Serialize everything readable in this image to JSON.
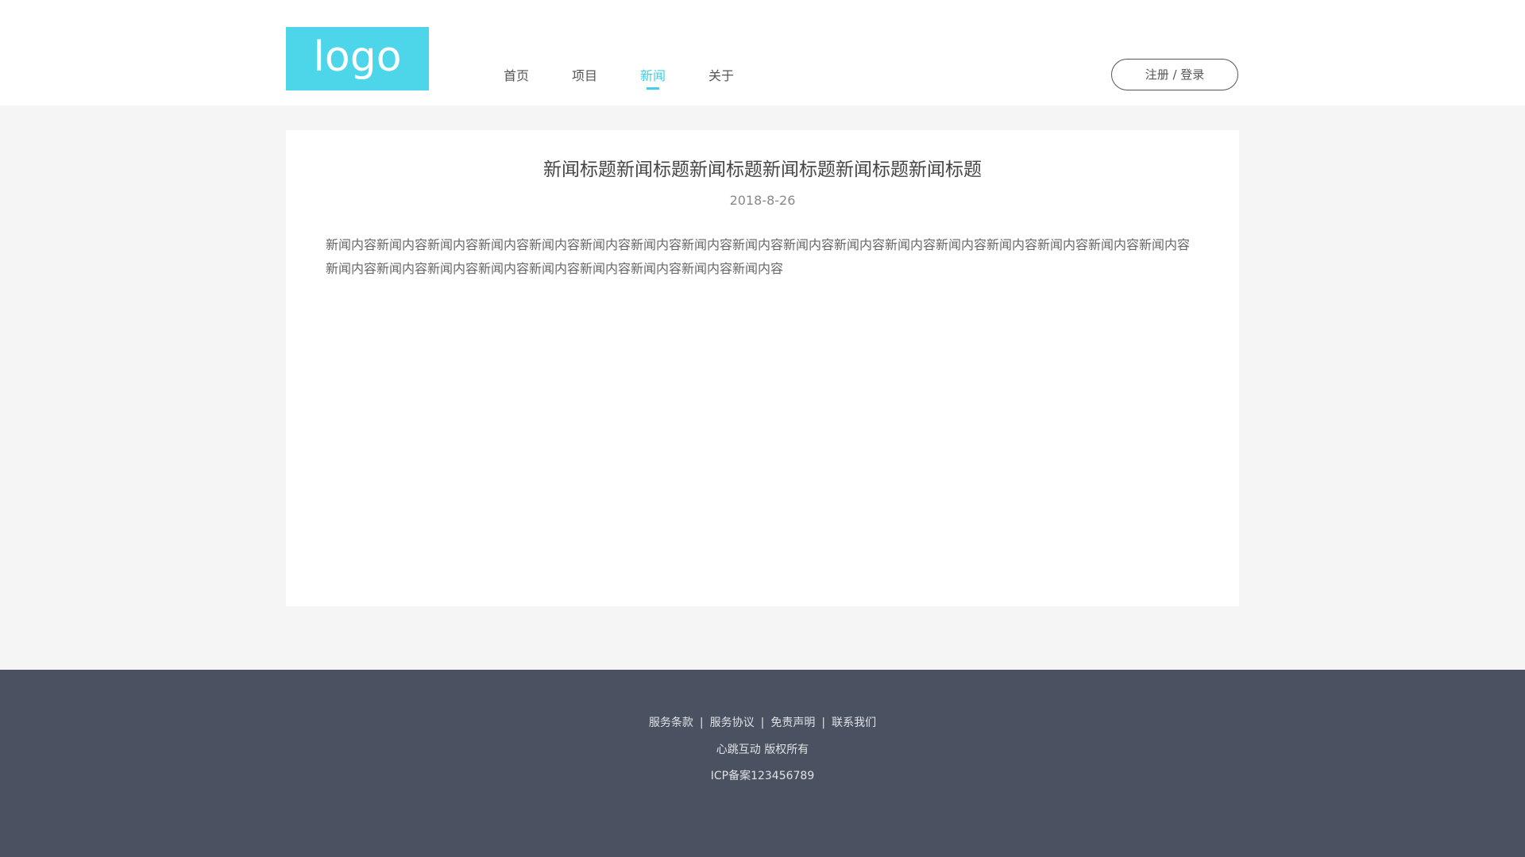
{
  "header": {
    "logo_text": "logo",
    "nav": [
      {
        "label": "首页",
        "active": false
      },
      {
        "label": "项目",
        "active": false
      },
      {
        "label": "新闻",
        "active": true
      },
      {
        "label": "关于",
        "active": false
      }
    ],
    "login_label": "注册 / 登录"
  },
  "article": {
    "title": "新闻标题新闻标题新闻标题新闻标题新闻标题新闻标题",
    "date": "2018-8-26",
    "body": "新闻内容新闻内容新闻内容新闻内容新闻内容新闻内容新闻内容新闻内容新闻内容新闻内容新闻内容新闻内容新闻内容新闻内容新闻内容新闻内容新闻内容新闻内容新闻内容新闻内容新闻内容新闻内容新闻内容新闻内容新闻内容新闻内容"
  },
  "footer": {
    "links": [
      "服务条款",
      "服务协议",
      "免责声明",
      "联系我们"
    ],
    "separator": "|",
    "copyright": "心跳互动 版权所有",
    "icp": "ICP备案123456789"
  },
  "colors": {
    "accent": "#3fd0e6",
    "logo_bg": "#4dd6ea",
    "page_bg": "#f5f5f5",
    "footer_bg": "#4a5160"
  }
}
